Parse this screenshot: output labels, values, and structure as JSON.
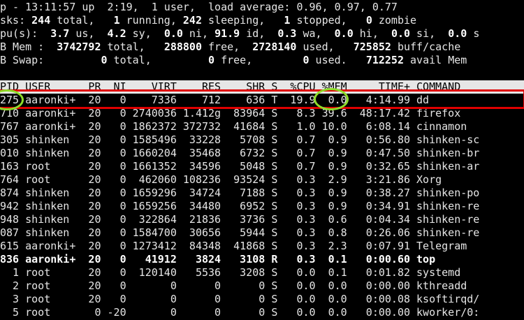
{
  "summary": {
    "uptime_line": "p - 13:11:57 up  2:19,  1 user,  load average: 0.96, 0.97, 0.77",
    "tasks": {
      "prefix": "sks: ",
      "total": "244",
      "t1": " total,   ",
      "running": "1",
      "t2": " running, ",
      "sleeping": "242",
      "t3": " sleeping,   ",
      "stopped": "1",
      "t4": " stopped,   ",
      "zombie": "0",
      "t5": " zombie"
    },
    "cpu": {
      "prefix": "pu(s):  ",
      "us": "3.7",
      "t1": " us,  ",
      "sy": "4.2",
      "t2": " sy,  ",
      "ni": "0.0",
      "t3": " ni, ",
      "id": "91.9",
      "t4": " id,  ",
      "wa": "0.3",
      "t5": " wa,  ",
      "hi": "0.0",
      "t6": " hi,  ",
      "si": "0.0",
      "t7": " si,  ",
      "st": "0.0",
      "t8": " s"
    },
    "mem": {
      "prefix": "B Mem : ",
      "total": " 3742792",
      "t1": " total,   ",
      "free": "288800",
      "t2": " free,  ",
      "used": "2728140",
      "t3": " used,   ",
      "buff": "725852",
      "t4": " buff/cache"
    },
    "swap": {
      "prefix": "B Swap:       ",
      "total": "  0",
      "t1": " total,         ",
      "free": "0",
      "t2": " free,        ",
      "used": "0",
      "t3": " used.   ",
      "avail": "712252",
      "t4": " avail Mem"
    }
  },
  "columns_header": "PID USER      PR  NI    VIRT    RES    SHR S  %CPU %MEM     TIME+ COMMAND",
  "processes": [
    {
      "text": "275 aaronki+  20   0    7336    712    636 T  19.9  0.0   4:14.99 dd",
      "bold": false
    },
    {
      "text": "710 aaronki+  20   0 2740036 1.412g  83964 S   8.3 39.6  48:17.42 firefox",
      "bold": false
    },
    {
      "text": "767 aaronki+  20   0 1862372 372732  41684 S   1.0 10.0   6:08.14 cinnamon",
      "bold": false
    },
    {
      "text": "305 shinken   20   0 1585496  33228   5708 S   0.7  0.9   0:56.80 shinken-sc",
      "bold": false
    },
    {
      "text": "010 shinken   20   0 1660204  35468   6732 S   0.7  0.9   0:47.50 shinken-br",
      "bold": false
    },
    {
      "text": "163 root      20   0 1661352  34596   5048 S   0.7  0.9   0:32.65 shinken-ar",
      "bold": false
    },
    {
      "text": "764 root      20   0  462060 108236  93524 S   0.3  2.9   3:21.86 Xorg",
      "bold": false
    },
    {
      "text": "874 shinken   20   0 1659296  34724   7188 S   0.3  0.9   0:38.27 shinken-po",
      "bold": false
    },
    {
      "text": "942 shinken   20   0 1659256  34480   6952 S   0.3  0.9   0:34.91 shinken-re",
      "bold": false
    },
    {
      "text": "948 shinken   20   0  322864  21836   3736 S   0.3  0.6   0:04.34 shinken-re",
      "bold": false
    },
    {
      "text": "087 shinken   20   0 1584700  30656   5944 S   0.3  0.8   0:26.06 shinken-re",
      "bold": false
    },
    {
      "text": "615 aaronki+  20   0 1273412  84348  41868 S   0.3  2.3   0:07.91 Telegram",
      "bold": false
    },
    {
      "text": "836 aaronki+  20   0   41912   3824   3108 R   0.3  0.1   0:00.60 top",
      "bold": true
    },
    {
      "text": "  1 root      20   0  120140   5536   3208 S   0.0  0.1   0:01.82 systemd",
      "bold": false
    },
    {
      "text": "  2 root      20   0       0      0      0 S   0.0  0.0   0:00.00 kthreadd",
      "bold": false
    },
    {
      "text": "  3 root      20   0       0      0      0 S   0.0  0.0   0:00.08 ksoftirqd/",
      "bold": false
    },
    {
      "text": "  5 root       0 -20       0      0      0 S   0.0  0.0   0:00.00 kworker/0:",
      "bold": false
    }
  ],
  "colors": {
    "background": "#000000",
    "text": "#e6e6e6",
    "highlight_box": "#e00000",
    "annotation_circle": "#8fdc2a"
  }
}
